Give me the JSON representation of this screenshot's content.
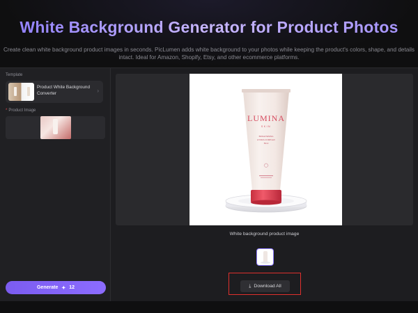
{
  "header": {
    "title": "White Background Generator for Product Photos",
    "description": "Create clean white background product images in seconds. PicLumen adds white background to your photos while keeping the product's colors, shape, and details intact. Ideal for Amazon, Shopify, Etsy, and other ecommerce platforms."
  },
  "sidebar": {
    "template_label": "Template",
    "template_name": "Product White Background Converter",
    "product_image_required_mark": "*",
    "product_image_label": "Product Image",
    "generate_label": "Generate",
    "generate_credits": "12"
  },
  "preview": {
    "brand": "LUMINA",
    "brand_sub": "SKIN",
    "tube_line1": "BRIGHTENING",
    "tube_line2": "HYDRA COMPLEX",
    "tube_line3": "50ml",
    "caption": "White background product image",
    "download_label": "Download All"
  },
  "icons": {
    "template_chevron": "chevron-right-icon",
    "credit": "lightning-icon",
    "download": "download-icon"
  },
  "colors": {
    "accent": "#8c6cff",
    "title_gradient_start": "#8e7dff",
    "highlight_border": "#e0302d",
    "tube_cap": "#e8455a"
  }
}
